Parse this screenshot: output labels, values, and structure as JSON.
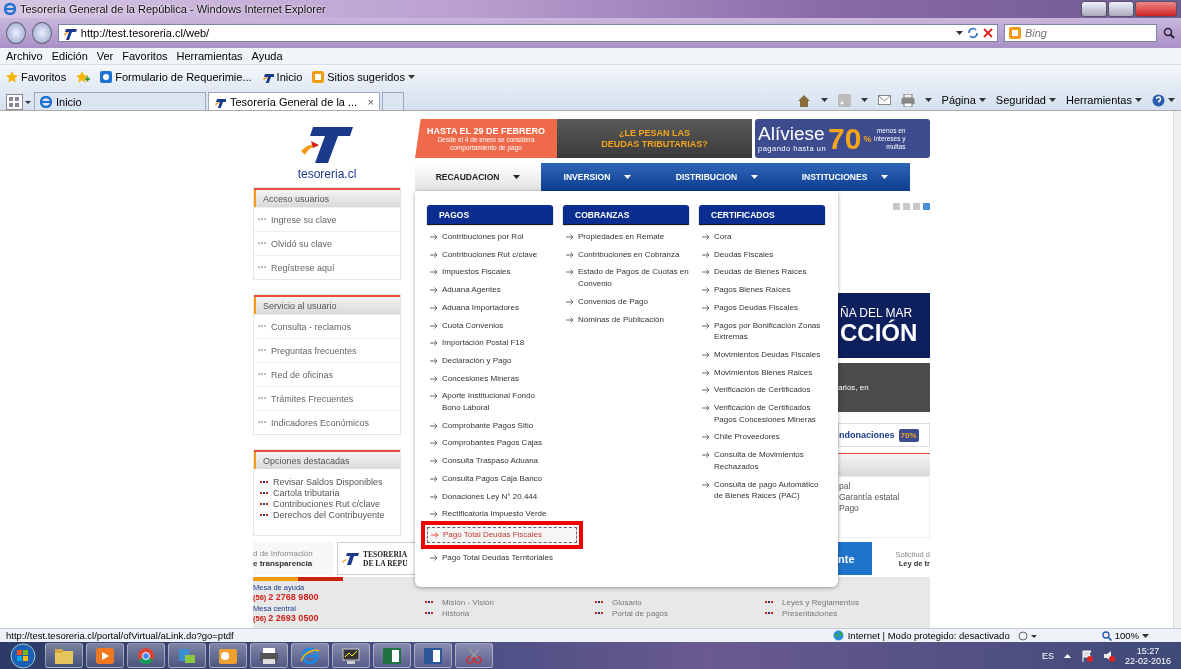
{
  "browser": {
    "title": "Tesorería General de la República - Windows Internet Explorer",
    "address": "http://test.tesoreria.cl/web/",
    "search_placeholder": "Bing",
    "menu": [
      "Archivo",
      "Edición",
      "Ver",
      "Favoritos",
      "Herramientas",
      "Ayuda"
    ],
    "favorites_button": "Favoritos",
    "favorites": [
      "Formulario de Requerimie...",
      "Inicio",
      "Sitios sugeridos"
    ],
    "tabs": [
      {
        "label": "Inicio",
        "selected": false
      },
      {
        "label": "Tesorería General de la ...",
        "selected": true
      }
    ],
    "tab_close": "×",
    "commands": [
      "Página",
      "Seguridad",
      "Herramientas"
    ]
  },
  "site": {
    "logo_text": "tesoreria.cl",
    "sidebar": [
      {
        "title": "Acceso usuarios",
        "kind": "links",
        "items": [
          "Ingrese su clave",
          "Olvidó su clave",
          "Regístrese aquí"
        ]
      },
      {
        "title": "Servicio al usuario",
        "kind": "links",
        "items": [
          "Consulta - reclamos",
          "Preguntas frecuentes",
          "Red de oficinas",
          "Trámites Frecuentes",
          "Indicadores Económicos"
        ]
      },
      {
        "title": "Opciones destacadas",
        "kind": "bullets",
        "items": [
          "Revisar Saldos Disponibles",
          "Cartola tributaria",
          "Contribuciones Rut c/clave",
          "Derechos del Contribuyente"
        ]
      }
    ],
    "promo": {
      "deadline": "HASTA EL 29 DE FEBRERO",
      "deadline_note": "Desde el 4 de enero se considera comportamiento de pago",
      "headline_1": "¿LE PESAN LAS",
      "headline_2": "DEUDAS TRIBUTARIAS?",
      "brand": "Alíviese",
      "subline": "pagando hasta un",
      "percent": "70",
      "percent_sign": "%",
      "tail": "menos en intereses y multas"
    },
    "nav": [
      {
        "label": "RECAUDACION",
        "selected": true
      },
      {
        "label": "INVERSION",
        "selected": false
      },
      {
        "label": "DISTRIBUCION",
        "selected": false
      },
      {
        "label": "INSTITUCIONES",
        "selected": false
      }
    ],
    "dropdown": {
      "columns": [
        {
          "title": "PAGOS",
          "items": [
            {
              "label": "Contribuciones por Rol",
              "highlighted": false
            },
            {
              "label": "Contribuciones Rut c/clave",
              "highlighted": false
            },
            {
              "label": "Impuestos Fiscales",
              "highlighted": false
            },
            {
              "label": "Aduana Agentes",
              "highlighted": false
            },
            {
              "label": "Aduana Importadores",
              "highlighted": false
            },
            {
              "label": "Cuota Convenios",
              "highlighted": false
            },
            {
              "label": "Importación Postal F18",
              "highlighted": false
            },
            {
              "label": "Declaración y Pago",
              "highlighted": false
            },
            {
              "label": "Concesiones Mineras",
              "highlighted": false
            },
            {
              "label": "Aporte Institucional Fondo Bono Laboral",
              "highlighted": false
            },
            {
              "label": "Comprobante Pagos Sitio",
              "highlighted": false
            },
            {
              "label": "Comprobantes Pagos Cajas",
              "highlighted": false
            },
            {
              "label": "Consulta Traspaso Aduana",
              "highlighted": false
            },
            {
              "label": "Consulta Pagos Caja Banco",
              "highlighted": false
            },
            {
              "label": "Donaciones Ley N° 20.444",
              "highlighted": false
            },
            {
              "label": "Rectificatoria Impuesto Verde",
              "highlighted": false
            },
            {
              "label": "Pago Total Deudas Fiscales",
              "highlighted": true
            },
            {
              "label": "Pago Total Deudas Territoriales",
              "highlighted": false
            }
          ]
        },
        {
          "title": "COBRANZAS",
          "items": [
            {
              "label": "Propiedades en Remate"
            },
            {
              "label": "Contribuciones en Cobranza"
            },
            {
              "label": "Estado de Pagos de Cuotas en Convenio"
            },
            {
              "label": "Convenios de Pago"
            },
            {
              "label": "Nóminas de Publicación"
            }
          ]
        },
        {
          "title": "CERTIFICADOS",
          "items": [
            {
              "label": "Cora"
            },
            {
              "label": "Deudas Fiscales"
            },
            {
              "label": "Deudas de Bienes Raíces"
            },
            {
              "label": "Pagos Bienes Raíces"
            },
            {
              "label": "Pagos Deudas Fiscales"
            },
            {
              "label": "Pagos por Bonificación Zonas Extremas"
            },
            {
              "label": "Movimientos Deudas Fiscales"
            },
            {
              "label": "Movimientos Bienes Raices"
            },
            {
              "label": "Verificación de Certificados"
            },
            {
              "label": "Verificación de Certificados Pagos Concesiones Mineras"
            },
            {
              "label": "Chile Proveedores"
            },
            {
              "label": "Consulta de Movimientos Rechazados"
            },
            {
              "label": "Consulta de pago Automático de Bienes Raices (PAC)"
            }
          ]
        }
      ]
    },
    "slides": [
      {
        "selected": false
      },
      {
        "selected": false
      },
      {
        "selected": false
      },
      {
        "selected": true
      }
    ],
    "behind": {
      "banner_1": "ÑA DEL MAR",
      "banner_2": "CCIÓN",
      "dark_text": "arios, en",
      "condonaciones": "ndonaciones",
      "badge": "70%",
      "panel_lines": [
        "pal",
        "Garantía estatal",
        "Pago"
      ],
      "blue_tile": "nte",
      "request_1": "Solicitud d",
      "request_2": "Ley de tr"
    },
    "transparency_1": "d de Información",
    "transparency_2": "e transparencia",
    "seal_1": "TESORERIA",
    "seal_2": "DE LA REPU",
    "contacts": [
      {
        "label": "Mesa de ayuda",
        "prefix": "(56)",
        "number": "2 2768 9800"
      },
      {
        "label": "Mesa central",
        "prefix": "(56)",
        "number": "2 2693 0500"
      }
    ],
    "footer_links": [
      "Misión - Visión",
      "Historia",
      "Glosario",
      "Portal de pagos",
      "Leyes y Reglamentos",
      "Presentaciones"
    ]
  },
  "status_bar": {
    "url": "http://test.tesoreria.cl/portal/ofVirtual/aLink.do?go=ptdf",
    "zone": "Internet | Modo protegido: desactivado",
    "zoom": "100%"
  },
  "taskbar": {
    "language": "ES",
    "time": "15:27",
    "date": "22-02-2016"
  }
}
